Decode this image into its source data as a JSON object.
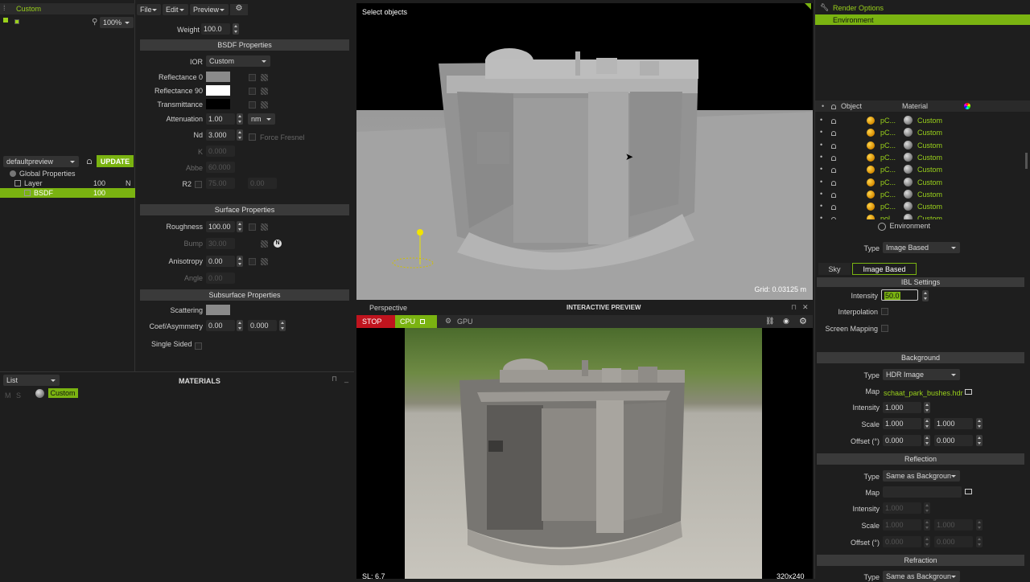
{
  "left_top": {
    "title": "Custom",
    "zoom": "100%"
  },
  "menu": {
    "file": "File",
    "edit": "Edit",
    "preview": "Preview"
  },
  "bsdf": {
    "weight_label": "Weight",
    "weight_value": "100.0",
    "header": "BSDF Properties",
    "ior_label": "IOR",
    "ior_value": "Custom",
    "refl0_label": "Reflectance 0",
    "refl90_label": "Reflectance 90",
    "trans_label": "Transmittance",
    "atten_label": "Attenuation",
    "atten_value": "1.00",
    "atten_unit": "nm",
    "nd_label": "Nd",
    "nd_value": "3.000",
    "force_fresnel": "Force Fresnel",
    "k_label": "K",
    "k_value": "0.000",
    "abbe_label": "Abbe",
    "abbe_value": "60.000",
    "r2_label": "R2",
    "r2_value1": "75.00",
    "r2_value2": "0.00"
  },
  "surface": {
    "header": "Surface Properties",
    "roughness_label": "Roughness",
    "roughness_value": "100.00",
    "bump_label": "Bump",
    "bump_value": "30.00",
    "aniso_label": "Anisotropy",
    "aniso_value": "0.00",
    "angle_label": "Angle",
    "angle_value": "0.00"
  },
  "subsurface": {
    "header": "Subsurface Properties",
    "scattering_label": "Scattering",
    "coef_label": "Coef/Asymmetry",
    "coef_value1": "0.00",
    "coef_value2": "0.000",
    "single_sided_label": "Single Sided"
  },
  "layers": {
    "preview_select": "defaultpreview",
    "update_btn": "UPDATE",
    "rows": [
      {
        "name": "Global Properties",
        "val": "",
        "flag": ""
      },
      {
        "name": "Layer",
        "val": "100",
        "flag": "N"
      },
      {
        "name": "BSDF",
        "val": "100",
        "flag": ""
      }
    ]
  },
  "materials": {
    "list_select": "List",
    "header": "MATERIALS",
    "items": [
      "Custom"
    ],
    "col_m": "M",
    "col_s": "S"
  },
  "viewport": {
    "title": "Select objects",
    "grid": "Grid: 0.03125 m",
    "camera": "Perspective"
  },
  "preview": {
    "header": "INTERACTIVE PREVIEW",
    "stop": "STOP",
    "cpu": "CPU",
    "gpu": "GPU",
    "sl": "SL: 6.7",
    "res": "320x240"
  },
  "right": {
    "render_options": "Render Options",
    "environment_tab": "Environment",
    "table_headers": {
      "object": "Object",
      "material": "Material"
    },
    "objects": [
      {
        "name": "pC...",
        "material": "Custom"
      },
      {
        "name": "pC...",
        "material": "Custom"
      },
      {
        "name": "pC...",
        "material": "Custom"
      },
      {
        "name": "pC...",
        "material": "Custom"
      },
      {
        "name": "pC...",
        "material": "Custom"
      },
      {
        "name": "pC...",
        "material": "Custom"
      },
      {
        "name": "pC...",
        "material": "Custom"
      },
      {
        "name": "pC...",
        "material": "Custom"
      },
      {
        "name": "pol...",
        "material": "Custom"
      }
    ],
    "env_title": "Environment",
    "type_label": "Type",
    "type_value": "Image Based",
    "tab_sky": "Sky",
    "tab_ibl": "Image Based",
    "ibl_header": "IBL Settings",
    "intensity_label": "Intensity",
    "intensity_value": "50.0",
    "interp_label": "Interpolation",
    "screen_map_label": "Screen Mapping",
    "bg_header": "Background",
    "bg_type_label": "Type",
    "bg_type_value": "HDR Image",
    "bg_map_label": "Map",
    "bg_map_value": "schaat_park_bushes.hdr",
    "bg_int_label": "Intensity",
    "bg_int_value": "1.000",
    "bg_scale_label": "Scale",
    "bg_scale_1": "1.000",
    "bg_scale_2": "1.000",
    "bg_offset_label": "Offset (°)",
    "bg_offset_1": "0.000",
    "bg_offset_2": "0.000",
    "refl_header": "Reflection",
    "refl_type_label": "Type",
    "refl_type_value": "Same as Backgroun",
    "refl_map_label": "Map",
    "refl_int_label": "Intensity",
    "refl_int_value": "1.000",
    "refl_scale_label": "Scale",
    "refl_scale_1": "1.000",
    "refl_scale_2": "1.000",
    "refl_offset_label": "Offset (°)",
    "refl_offset_1": "0.000",
    "refl_offset_2": "0.000",
    "refr_header": "Refraction",
    "refr_type_label": "Type",
    "refr_type_value": "Same as Backgroun"
  },
  "colors": {
    "accent": "#7ab311",
    "stop": "#c0141e",
    "panel": "#1e1e1e"
  }
}
